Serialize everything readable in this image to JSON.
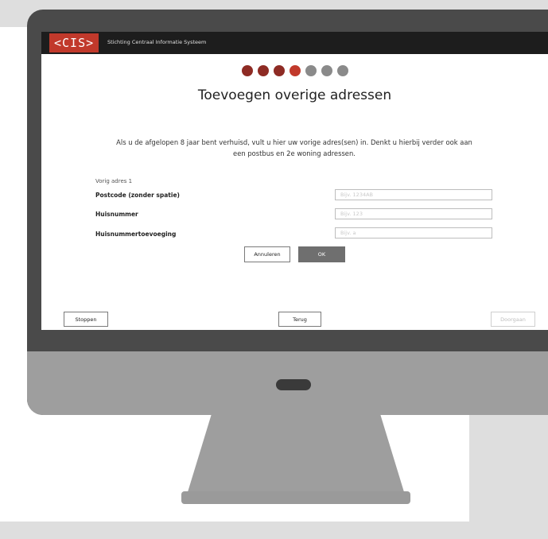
{
  "app": {
    "logo_text": "<CIS>",
    "org_name": "Stichting Centraal Informatie Systeem"
  },
  "progress": {
    "total_steps": 7,
    "completed_steps": 4,
    "colors": {
      "done": "#8e2b24",
      "current": "#c1392b",
      "todo": "#8a8a8a"
    }
  },
  "main": {
    "title": "Toevoegen overige adressen",
    "intro_line1": "Als u de afgelopen 8 jaar bent verhuisd, vult u hier uw vorige adres(sen) in. Denkt u hierbij verder ook aan",
    "intro_line2": "een postbus en 2e woning adressen."
  },
  "form": {
    "section_label": "Vorig adres 1",
    "postcode_label": "Postcode (zonder spatie)",
    "postcode_placeholder": "Bijv. 1234AB",
    "huisnummer_label": "Huisnummer",
    "huisnummer_placeholder": "Bijv. 123",
    "toevoeging_label": "Huisnummertoevoeging",
    "toevoeging_placeholder": "Bijv. a",
    "cancel_label": "Annuleren",
    "ok_label": "OK"
  },
  "footer": {
    "stop_label": "Stoppen",
    "back_label": "Terug",
    "next_label": "Doorgaan"
  }
}
